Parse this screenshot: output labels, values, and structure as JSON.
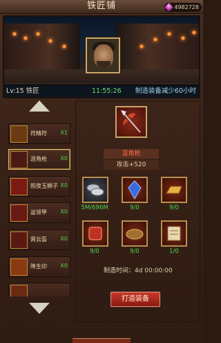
{
  "header": {
    "title": "铁匠铺",
    "currency_value": "4982728"
  },
  "banner": {
    "level_label": "Lv:15 铁匠",
    "timer": "11:55:26",
    "bonus_text": "制造装备减少60小时"
  },
  "list": {
    "items": [
      {
        "name": "符精符",
        "count": "X1",
        "icon": "talisman-icon"
      },
      {
        "name": "涯角枪",
        "count": "X0",
        "icon": "spear-icon"
      },
      {
        "name": "照夜玉狮子",
        "count": "X0",
        "icon": "horse-icon"
      },
      {
        "name": "盆领甲",
        "count": "X0",
        "icon": "armor-icon"
      },
      {
        "name": "霄云盔",
        "count": "X0",
        "icon": "helmet-icon"
      },
      {
        "name": "降生印",
        "count": "X0",
        "icon": "seal-icon"
      },
      {
        "name": "",
        "count": "",
        "icon": "partial-item-icon"
      }
    ],
    "selected_index": 1
  },
  "detail": {
    "name": "涯角枪",
    "stat": "攻击+520",
    "icon": "spear-icon",
    "materials": [
      {
        "icon": "coins-icon",
        "count": "5M/696M"
      },
      {
        "icon": "crystal-icon",
        "count": "9/0"
      },
      {
        "icon": "gold-bar-icon",
        "count": "9/0"
      },
      {
        "icon": "cloth-icon",
        "count": "9/0"
      },
      {
        "icon": "ore-icon",
        "count": "9/0"
      },
      {
        "icon": "scroll-icon",
        "count": "1/0"
      }
    ],
    "craft_time": "制造时间：4d 00:00:00",
    "craft_button": "打造装备"
  },
  "colors": {
    "accent_red": "#c8392a",
    "count_green": "#4fd84f",
    "timer_green": "#6ee06e",
    "gold_border": "#c9a86a"
  }
}
